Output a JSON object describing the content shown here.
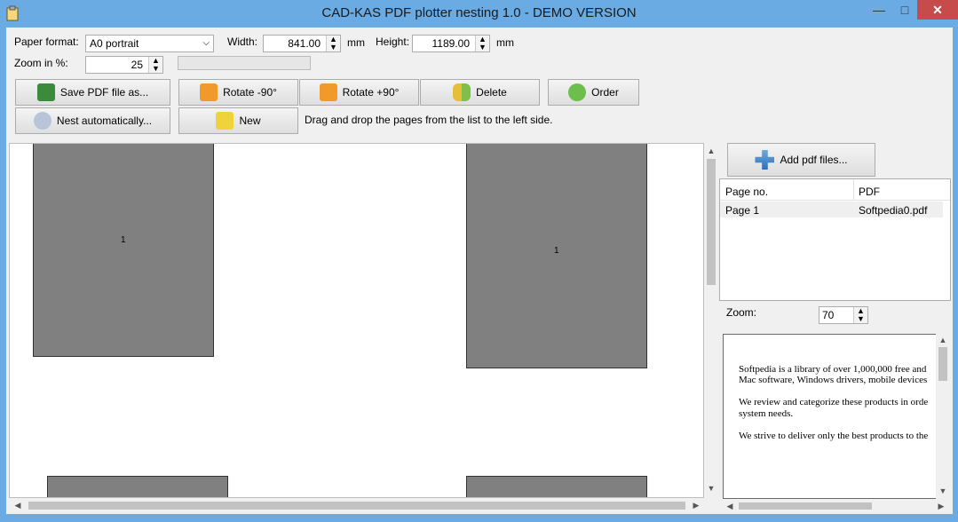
{
  "window": {
    "title": "CAD-KAS PDF plotter nesting 1.0 - DEMO VERSION",
    "minimize": "—",
    "maximize": "□",
    "close": "✕"
  },
  "settings": {
    "paper_format_label": "Paper format:",
    "paper_format_value": "A0 portrait",
    "width_label": "Width:",
    "width_value": "841.00",
    "width_unit": "mm",
    "height_label": "Height:",
    "height_value": "1189.00",
    "height_unit": "mm",
    "zoom_label": "Zoom in %:",
    "zoom_value": "25"
  },
  "toolbar": {
    "save_pdf": "Save PDF file as...",
    "rotate_left": "Rotate -90°",
    "rotate_right": "Rotate +90°",
    "delete": "Delete",
    "order": "Order",
    "nest_auto": "Nest automatically...",
    "new": "New",
    "hint": "Drag and drop the pages from the list to the left side."
  },
  "canvas": {
    "page_labels": [
      "1",
      "1"
    ]
  },
  "right_panel": {
    "add_pdf": "Add pdf files...",
    "columns": [
      "Page no.",
      "PDF"
    ],
    "rows": [
      [
        "Page 1",
        "Softpedia0.pdf"
      ]
    ],
    "zoom_label": "Zoom:",
    "zoom_value": "70",
    "preview_text": [
      "Softpedia is a library of over 1,000,000 free and",
      "Mac software, Windows drivers, mobile devices",
      "We review and categorize these products in orde",
      "system needs.",
      "We strive to deliver only the best products to the"
    ]
  },
  "icons": {
    "app": "clipboard-icon",
    "save": "floppy-disk-icon",
    "rotate_left": "rotate-ccw-icon",
    "rotate_right": "rotate-cw-icon",
    "delete": "eraser-icon",
    "order": "globe-arrows-icon",
    "nest": "recycle-arrows-icon",
    "new": "broom-icon",
    "add": "plus-icon"
  },
  "colors": {
    "titlebar": "#6aabe4",
    "close": "#c74b4b",
    "page_fill": "#808080"
  }
}
